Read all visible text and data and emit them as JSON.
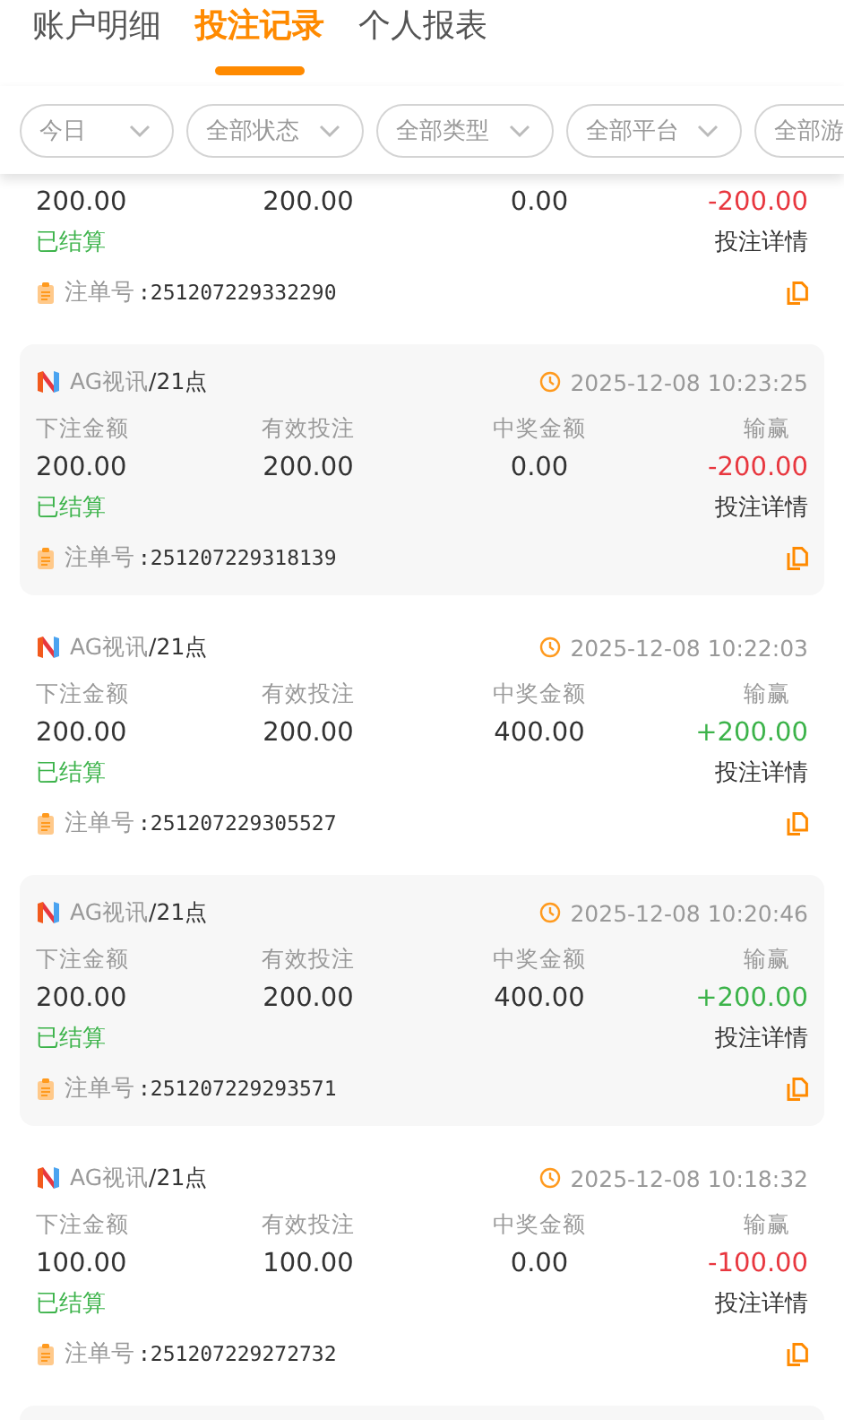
{
  "tabs": [
    {
      "label": "账户明细",
      "selected": false
    },
    {
      "label": "投注记录",
      "selected": true
    },
    {
      "label": "个人报表",
      "selected": false
    }
  ],
  "filters": [
    "今日",
    "全部状态",
    "全部类型",
    "全部平台",
    "全部游"
  ],
  "records": [
    {
      "columns": [
        {
          "value": "200.00"
        },
        {
          "value": "200.00"
        },
        {
          "value": "0.00"
        },
        {
          "value": "-200.00",
          "kind": "loss"
        }
      ],
      "status": "已结算",
      "details": "投注详情",
      "order_label": "注单号",
      "order_no": ":251207229332290"
    },
    {
      "platform": "AG视讯",
      "game": "/21点",
      "time": "2025-12-08 10:23:25",
      "columns": [
        {
          "label": "下注金额",
          "value": "200.00"
        },
        {
          "label": "有效投注",
          "value": "200.00"
        },
        {
          "label": "中奖金额",
          "value": "0.00"
        },
        {
          "label": "输赢",
          "value": "-200.00",
          "kind": "loss"
        }
      ],
      "status": "已结算",
      "details": "投注详情",
      "order_label": "注单号",
      "order_no": ":251207229318139"
    },
    {
      "platform": "AG视讯",
      "game": "/21点",
      "time": "2025-12-08 10:22:03",
      "columns": [
        {
          "label": "下注金额",
          "value": "200.00"
        },
        {
          "label": "有效投注",
          "value": "200.00"
        },
        {
          "label": "中奖金额",
          "value": "400.00"
        },
        {
          "label": "输赢",
          "value": "+200.00",
          "kind": "win"
        }
      ],
      "status": "已结算",
      "details": "投注详情",
      "order_label": "注单号",
      "order_no": ":251207229305527"
    },
    {
      "platform": "AG视讯",
      "game": "/21点",
      "time": "2025-12-08 10:20:46",
      "columns": [
        {
          "label": "下注金额",
          "value": "200.00"
        },
        {
          "label": "有效投注",
          "value": "200.00"
        },
        {
          "label": "中奖金额",
          "value": "400.00"
        },
        {
          "label": "输赢",
          "value": "+200.00",
          "kind": "win"
        }
      ],
      "status": "已结算",
      "details": "投注详情",
      "order_label": "注单号",
      "order_no": ":251207229293571"
    },
    {
      "platform": "AG视讯",
      "game": "/21点",
      "time": "2025-12-08 10:18:32",
      "columns": [
        {
          "label": "下注金额",
          "value": "100.00"
        },
        {
          "label": "有效投注",
          "value": "100.00"
        },
        {
          "label": "中奖金额",
          "value": "0.00"
        },
        {
          "label": "输赢",
          "value": "-100.00",
          "kind": "loss"
        }
      ],
      "status": "已结算",
      "details": "投注详情",
      "order_label": "注单号",
      "order_no": ":251207229272732"
    }
  ]
}
